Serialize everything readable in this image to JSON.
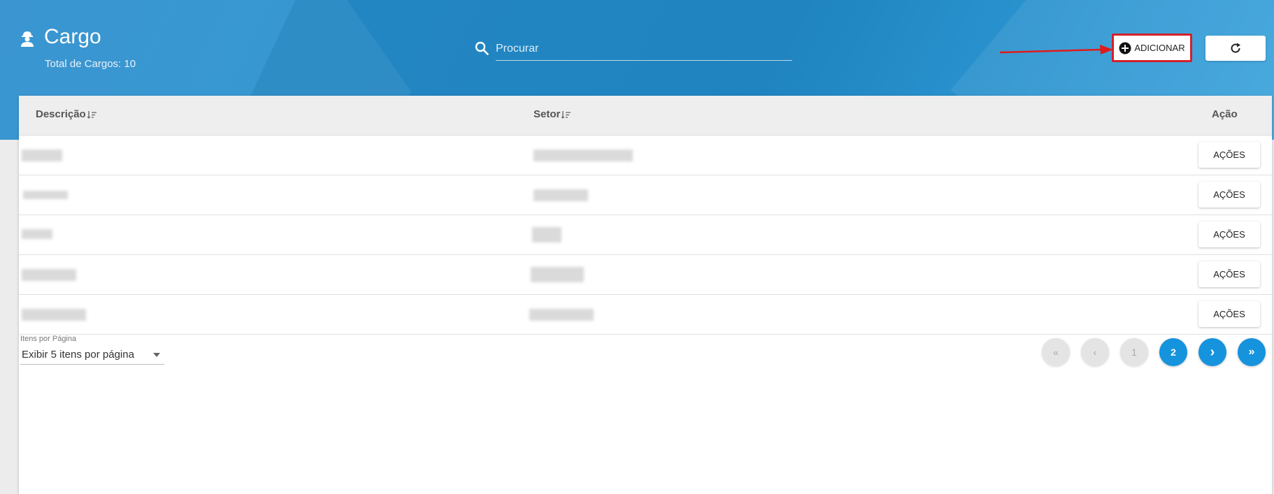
{
  "header": {
    "title": "Cargo",
    "subtitle": "Total de Cargos: 10",
    "search_placeholder": "Procurar",
    "add_label": "ADICIONAR"
  },
  "table": {
    "columns": [
      "Descrição",
      "Setor",
      "Ação"
    ],
    "row_action_label": "AÇÕES",
    "rows": [
      {
        "descricao": "",
        "setor": ""
      },
      {
        "descricao": "",
        "setor": ""
      },
      {
        "descricao": "",
        "setor": ""
      },
      {
        "descricao": "",
        "setor": ""
      },
      {
        "descricao": "",
        "setor": ""
      }
    ]
  },
  "pagination": {
    "per_page_label": "Itens por Página",
    "per_page_value": "Exibir 5 itens por página",
    "first": "«",
    "prev": "‹",
    "pages": [
      "1",
      "2"
    ],
    "current_page": "2",
    "next": "›",
    "last": "»"
  },
  "colors": {
    "header_blue": "#1f84c0",
    "highlight_red": "#d3202a",
    "page_active": "#1593dd"
  },
  "icons": {
    "title": "worker-icon",
    "search": "search-icon",
    "add": "plus-circle-icon",
    "refresh": "refresh-icon",
    "sort": "sort-icon"
  }
}
